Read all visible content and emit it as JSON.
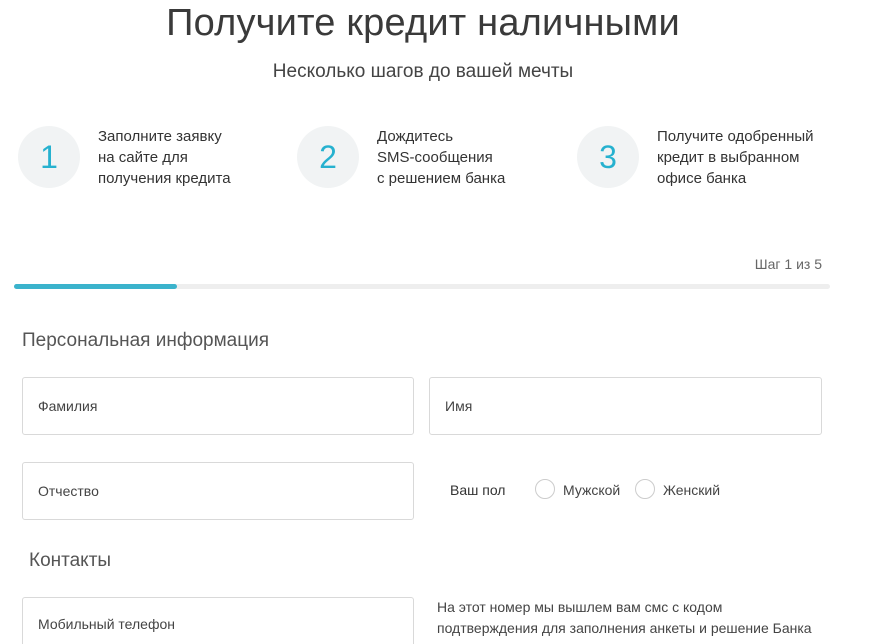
{
  "header": {
    "title": "Получите кредит наличными",
    "subtitle": "Несколько шагов до вашей мечты"
  },
  "steps": [
    {
      "number": "1",
      "text": "Заполните заявку\nна сайте для\nполучения кредита"
    },
    {
      "number": "2",
      "text": "Дождитесь\nSMS-сообщения\nс решением банка"
    },
    {
      "number": "3",
      "text": "Получите одобренный\nкредит в выбранном\nофисе банка"
    }
  ],
  "progress": {
    "label": "Шаг 1 из 5",
    "current_step": 1,
    "total_steps": 5
  },
  "personal": {
    "title": "Персональная информация",
    "last_name_placeholder": "Фамилия",
    "first_name_placeholder": "Имя",
    "middle_name_placeholder": "Отчество",
    "gender_label": "Ваш пол",
    "gender_options": [
      "Мужской",
      "Женский"
    ]
  },
  "contacts": {
    "title": "Контакты",
    "phone_placeholder": "Мобильный телефон",
    "phone_hint": "На этот номер мы вышлем вам смс с кодом\nподтверждения для заполнения анкеты и решение Банка"
  },
  "colors": {
    "accent": "#3bb3cc",
    "step_number": "#26b1cf",
    "circle_bg": "#f1f3f4"
  }
}
